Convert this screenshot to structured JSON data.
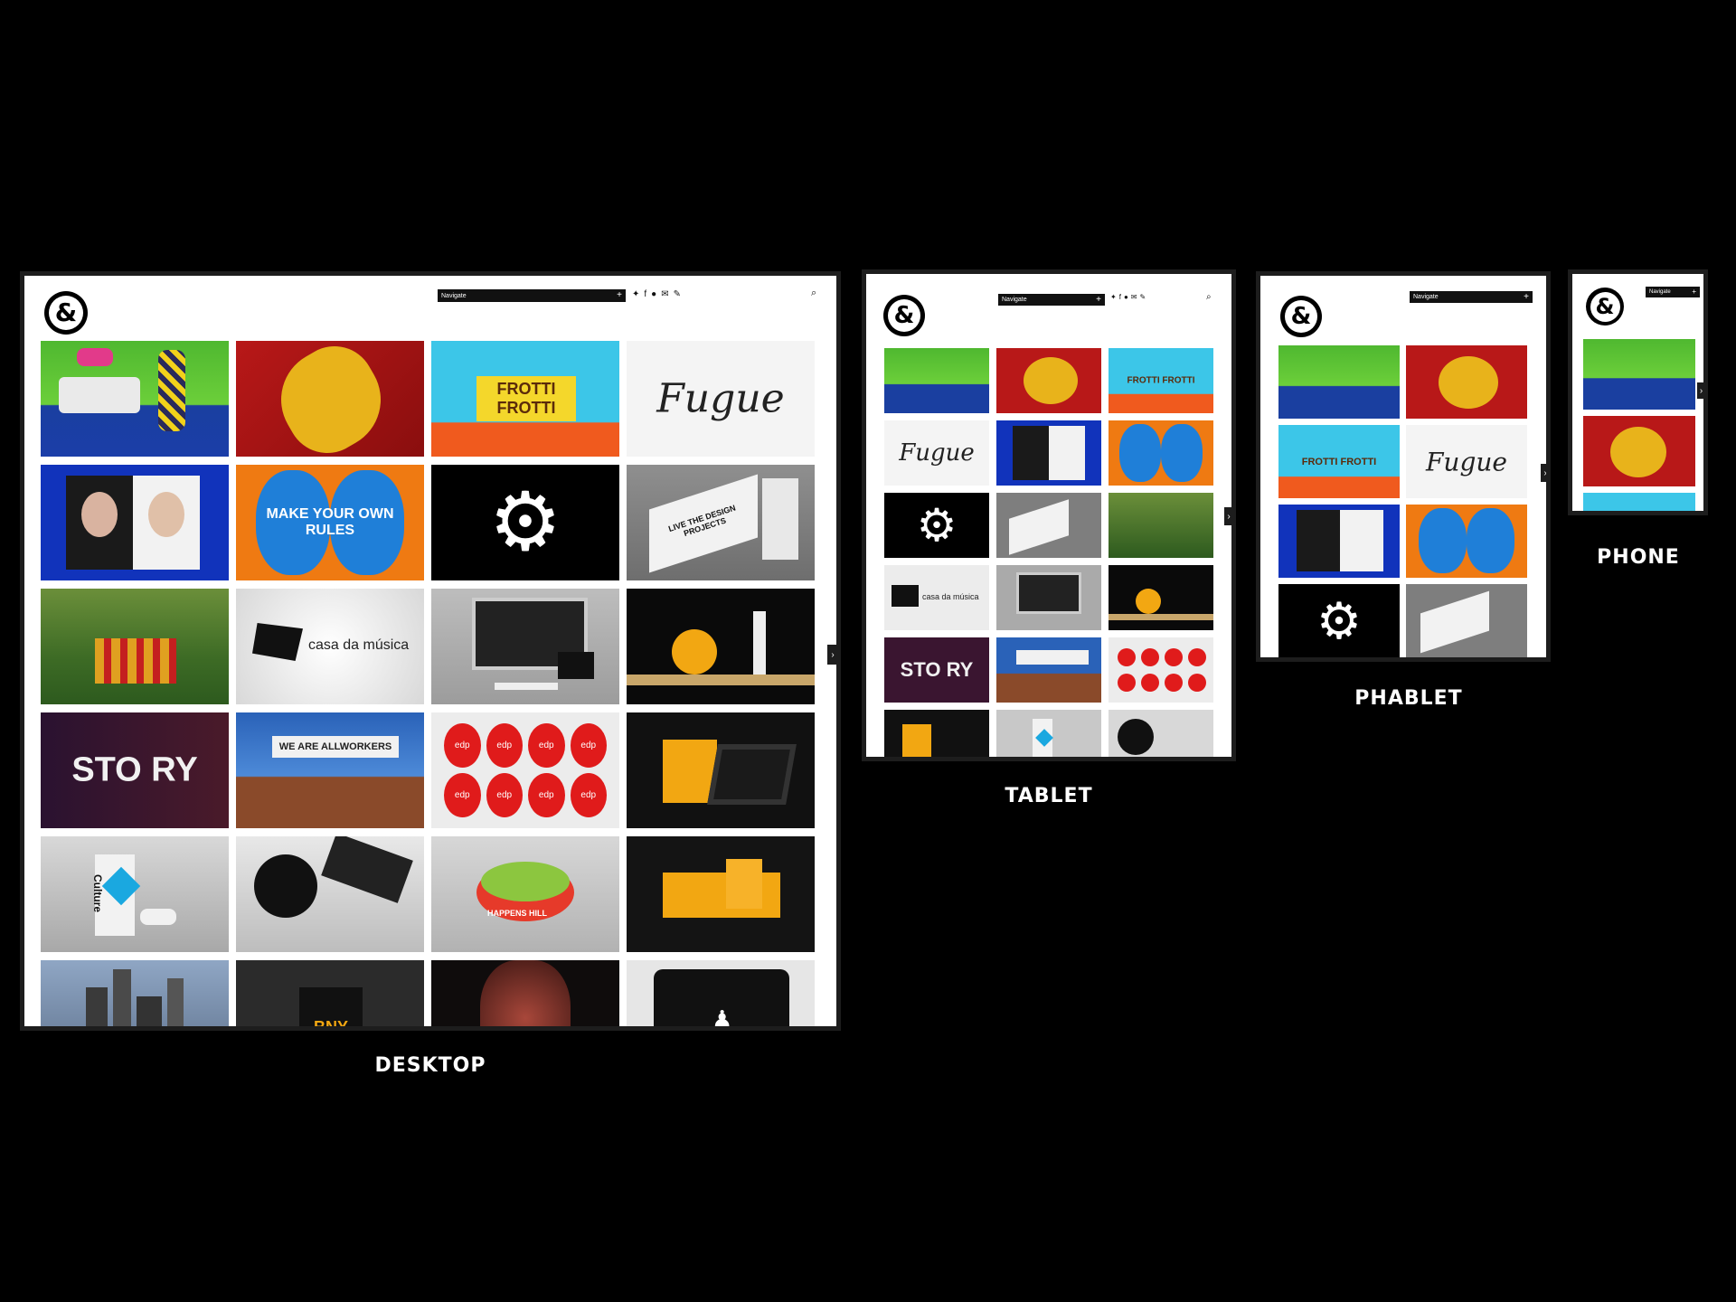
{
  "labels": {
    "desktop": "DESKTOP",
    "tablet": "TABLET",
    "phablet": "PHABLET",
    "phone": "PHONE"
  },
  "header": {
    "logo_glyph": "&",
    "navigate_label": "Navigate",
    "navigate_plus": "+",
    "search_icon": "⌕",
    "next_arrow": "›"
  },
  "socials": [
    {
      "name": "twitter-icon",
      "glyph": "✦"
    },
    {
      "name": "facebook-icon",
      "glyph": "f"
    },
    {
      "name": "flickr-icon",
      "glyph": "●"
    },
    {
      "name": "mail-icon",
      "glyph": "✉"
    },
    {
      "name": "pencil-icon",
      "glyph": "✎"
    }
  ],
  "tiles": {
    "froti": "FROTTI FROTTI",
    "fugue": "Fugue",
    "make": "MAKE YOUR OWN RULES",
    "casa": "casa da música",
    "story": "STO RY",
    "workers": "WE ARE ALLWORKERS",
    "edp": "edp",
    "culture": "Culture",
    "happens": "HAPPENS HILL",
    "bny": "BNY",
    "live": "LIVE THE DESIGN PROJECTS"
  },
  "colors": {
    "background": "#000000",
    "device_frame": "#1d1d1d",
    "page": "#ffffff",
    "nav_bar": "#111111"
  }
}
